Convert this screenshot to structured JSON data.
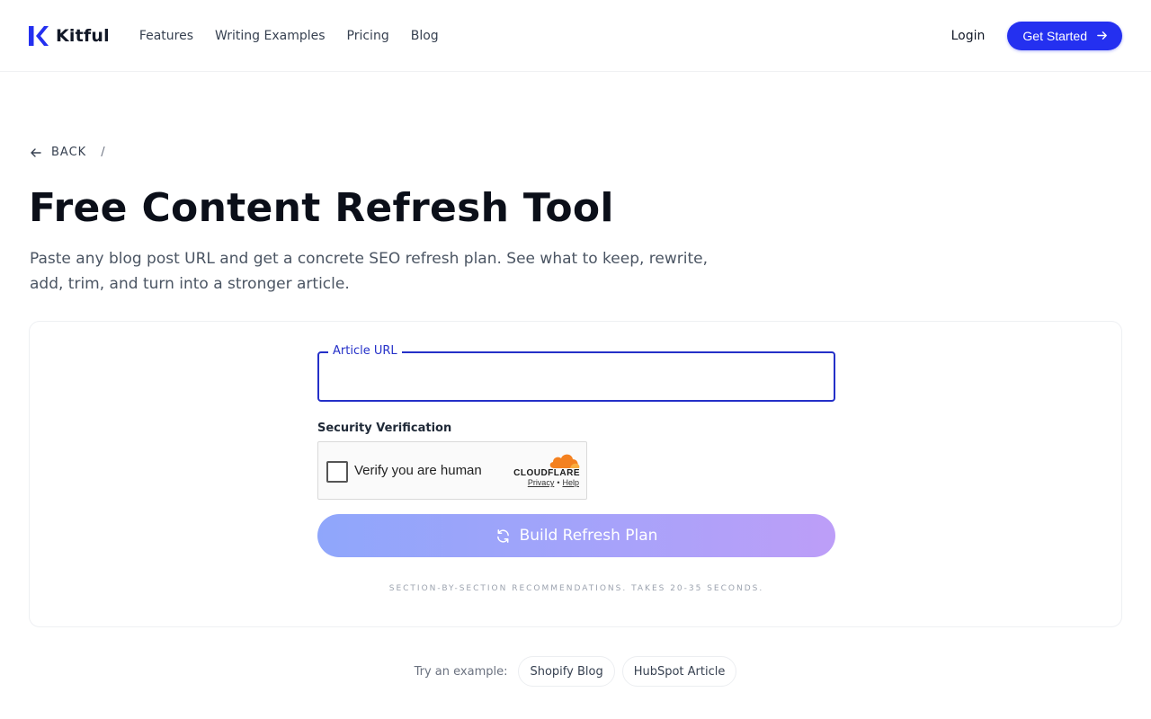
{
  "brand": {
    "name": "Kitful",
    "accent": "#2430f0"
  },
  "nav": {
    "items": [
      {
        "label": "Features"
      },
      {
        "label": "Writing Examples"
      },
      {
        "label": "Pricing"
      },
      {
        "label": "Blog"
      }
    ],
    "login": "Login",
    "cta": "Get Started"
  },
  "breadcrumb": {
    "back": "BACK",
    "separator": "/"
  },
  "hero": {
    "title": "Free Content Refresh Tool",
    "subtitle": "Paste any blog post URL and get a concrete SEO refresh plan. See what to keep, rewrite, add, trim, and turn into a stronger article."
  },
  "form": {
    "url_label": "Article URL",
    "url_value": "",
    "security_label": "Security Verification",
    "captcha": {
      "text": "Verify you are human",
      "provider": "CLOUDFLARE",
      "privacy": "Privacy",
      "dot": "•",
      "help": "Help"
    },
    "submit": "Build Refresh Plan",
    "helper": "SECTION-BY-SECTION RECOMMENDATIONS. TAKES 20-35 SECONDS."
  },
  "examples": {
    "label": "Try an example:",
    "items": [
      {
        "label": "Shopify Blog"
      },
      {
        "label": "HubSpot Article"
      }
    ]
  }
}
